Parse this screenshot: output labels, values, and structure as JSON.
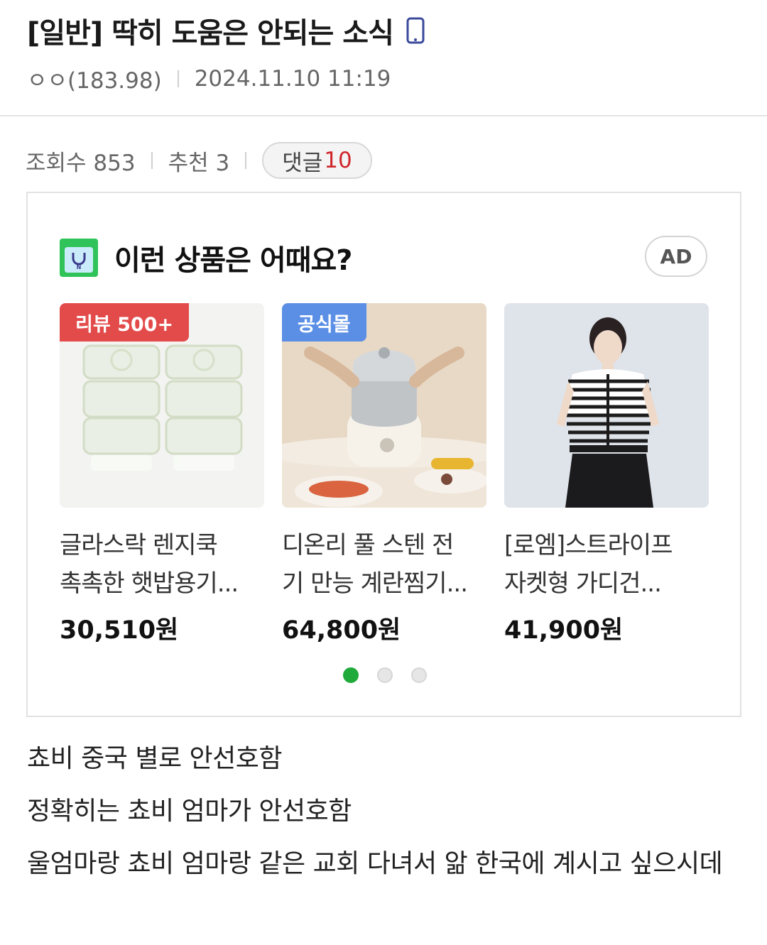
{
  "post": {
    "title": "[일반] 딱히 도움은 안되는 소식",
    "title_icon": "mobile-phone-icon",
    "author": "ㅇㅇ(183.98)",
    "datetime": "2024.11.10 11:19"
  },
  "stats": {
    "views": "조회수 853",
    "recommend": "추천 3",
    "comment_label": "댓글",
    "comment_count": "10"
  },
  "ad": {
    "title": "이런 상품은 어때요?",
    "badge": "AD",
    "logo_icon": "shopping-bag-icon",
    "products": [
      {
        "tag": "리뷰 500+",
        "name_line1": "글라스락 렌지쿡",
        "name_line2": "촉촉한 햇밥용기...",
        "price": "30,510원"
      },
      {
        "tag": "공식몰",
        "name_line1": "디온리 풀 스텐 전",
        "name_line2": "기 만능 계란찜기...",
        "price": "64,800원"
      },
      {
        "tag": "",
        "name_line1": "[로엠]스트라이프",
        "name_line2": "자켓형 가디건...",
        "price": "41,900원"
      }
    ],
    "carousel_pages": 3,
    "carousel_active": 1
  },
  "body": {
    "lines": [
      "쵸비 중국 별로 안선호함",
      "정확히는 쵸비 엄마가 안선호함",
      "울엄마랑 쵸비 엄마랑 같은 교회 다녀서 앎 한국에 계시고 싶으시데"
    ]
  },
  "colors": {
    "comment_count": "#d0262c",
    "carousel_active": "#1faa3a",
    "tag_review": "#e34b4b",
    "tag_official": "#5b8fe6"
  }
}
